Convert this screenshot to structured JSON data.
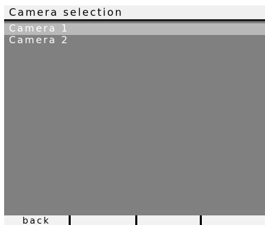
{
  "header": {
    "title": "Camera selection"
  },
  "camera_list": {
    "items": [
      {
        "label": "Camera 1",
        "selected": true
      },
      {
        "label": "Camera 2",
        "selected": false
      }
    ]
  },
  "softkeys": {
    "key1": "back",
    "key2": "",
    "key3": "",
    "key4": ""
  },
  "colors": {
    "background": "#808080",
    "title_bar": "#f0f0f0",
    "selection_highlight": "#b9b9b9",
    "item_text": "#ffffff",
    "softkey_bar": "#f2f2f2"
  }
}
